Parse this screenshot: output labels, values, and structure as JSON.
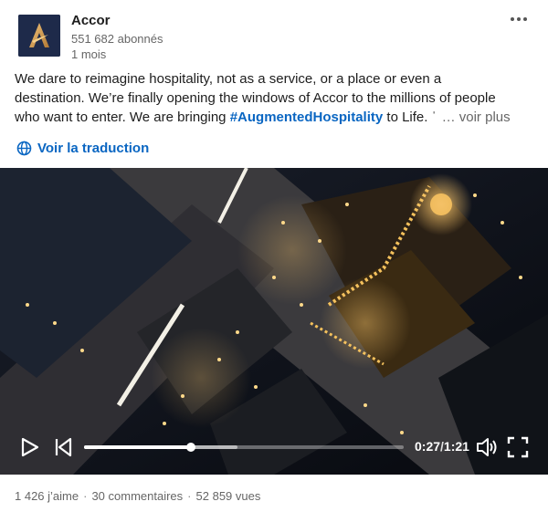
{
  "company": {
    "name": "Accor",
    "followers": "551 682 abonnés",
    "posted": "1 mois",
    "logo_icon": "accor-logo-icon",
    "logo_bg": "#1e2a4a",
    "logo_accent": "#d6a55a"
  },
  "post": {
    "lines": [
      "We dare to reimagine hospitality, not as a service, or a place or even a",
      "destination. We’re finally opening the windows of Accor to the millions of people"
    ],
    "line3_prefix": "who want to enter. We are bringing ",
    "hashtag": "#AugmentedHospitality",
    "line3_suffix": " to Life. ˈ",
    "see_more": "… voir plus"
  },
  "translate": {
    "label": "Voir la traduction",
    "icon": "globe-icon"
  },
  "video": {
    "current_time": "0:27",
    "duration": "1:21",
    "progress": 0.333,
    "buffered": 0.48,
    "icons": [
      "play-icon",
      "rewind-icon",
      "volume-icon",
      "fullscreen-icon"
    ]
  },
  "social": {
    "likes": "1 426 j’aime",
    "comments": "30 commentaires",
    "views": "52 859 vues"
  },
  "colors": {
    "link": "#0a66c2",
    "muted": "#666666"
  }
}
